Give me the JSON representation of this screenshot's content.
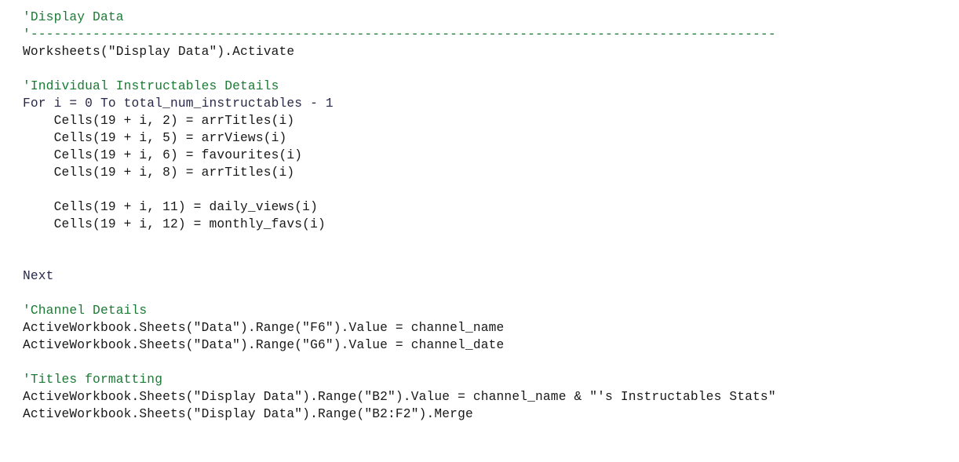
{
  "editor": {
    "language": "VBA",
    "background_color": "#ffffff",
    "comment_color": "#1b7a34",
    "code_color": "#181818",
    "keyword_color": "#282848"
  },
  "code": {
    "lines": [
      {
        "text": "'Display Data",
        "type": "comment"
      },
      {
        "text": "'------------------------------------------------------------------------------------------------",
        "type": "comment"
      },
      {
        "text": "Worksheets(\"Display Data\").Activate",
        "type": "code"
      },
      {
        "text": "",
        "type": "blank"
      },
      {
        "text": "'Individual Instructables Details",
        "type": "comment"
      },
      {
        "text": "For i = 0 To total_num_instructables - 1",
        "type": "keyword"
      },
      {
        "text": "    Cells(19 + i, 2) = arrTitles(i)",
        "type": "code"
      },
      {
        "text": "    Cells(19 + i, 5) = arrViews(i)",
        "type": "code"
      },
      {
        "text": "    Cells(19 + i, 6) = favourites(i)",
        "type": "code"
      },
      {
        "text": "    Cells(19 + i, 8) = arrTitles(i)",
        "type": "code"
      },
      {
        "text": "",
        "type": "blank"
      },
      {
        "text": "    Cells(19 + i, 11) = daily_views(i)",
        "type": "code"
      },
      {
        "text": "    Cells(19 + i, 12) = monthly_favs(i)",
        "type": "code"
      },
      {
        "text": "",
        "type": "blank"
      },
      {
        "text": "",
        "type": "blank"
      },
      {
        "text": "Next",
        "type": "keyword"
      },
      {
        "text": "",
        "type": "blank"
      },
      {
        "text": "'Channel Details",
        "type": "comment"
      },
      {
        "text": "ActiveWorkbook.Sheets(\"Data\").Range(\"F6\").Value = channel_name",
        "type": "code"
      },
      {
        "text": "ActiveWorkbook.Sheets(\"Data\").Range(\"G6\").Value = channel_date",
        "type": "code"
      },
      {
        "text": "",
        "type": "blank"
      },
      {
        "text": "'Titles formatting",
        "type": "comment"
      },
      {
        "text": "ActiveWorkbook.Sheets(\"Display Data\").Range(\"B2\").Value = channel_name & \"'s Instructables Stats\"",
        "type": "code"
      },
      {
        "text": "ActiveWorkbook.Sheets(\"Display Data\").Range(\"B2:F2\").Merge",
        "type": "code"
      }
    ]
  }
}
